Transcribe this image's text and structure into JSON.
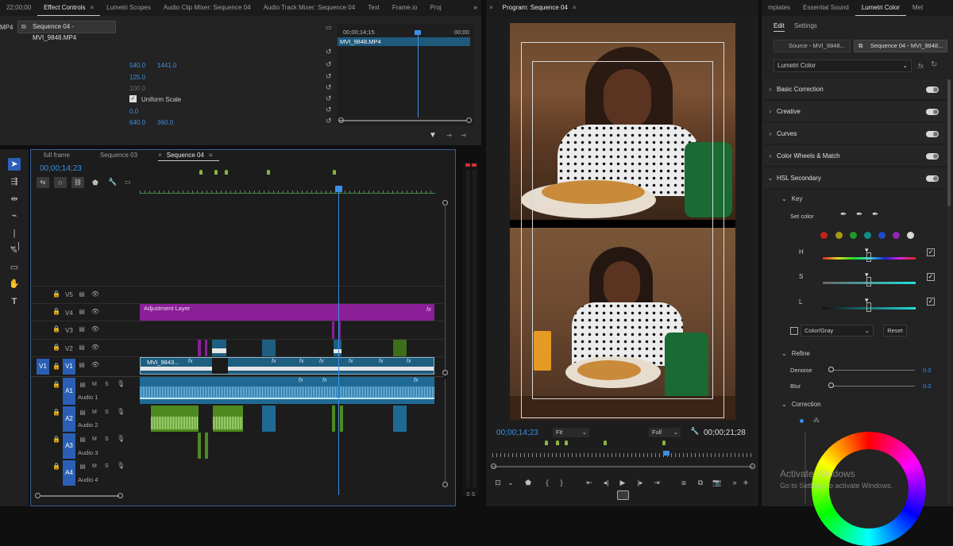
{
  "effect_controls": {
    "tabs": [
      {
        "label": "22;00;00",
        "active": false
      },
      {
        "label": "Effect Controls",
        "active": true
      },
      {
        "label": "Lumetri Scopes",
        "active": false
      },
      {
        "label": "Audio Clip Mixer: Sequence 04",
        "active": false
      },
      {
        "label": "Audio Track Mixer: Sequence 04",
        "active": false
      },
      {
        "label": "Text",
        "active": false
      },
      {
        "label": "Frame.io",
        "active": false
      },
      {
        "label": "Proj",
        "active": false
      }
    ],
    "source_left": "MP4",
    "source_dropdown": "Sequence 04 - MVI_9848.MP4",
    "position_x": "540.0",
    "position_y": "1441.0",
    "scale": "125.0",
    "scale_width": "100.0",
    "uniform_scale": "Uniform Scale",
    "rotation": "0.0",
    "anchor_x": "640.0",
    "anchor_y": "360.0",
    "ruler_start": "00;00;14;15",
    "ruler_end": "00;00",
    "clip_name": "MVI_9848.MP4"
  },
  "timeline": {
    "tabs": [
      {
        "label": "full frame",
        "active": false
      },
      {
        "label": "Sequence 03",
        "active": false
      },
      {
        "label": "Sequence 04",
        "active": true
      }
    ],
    "close_glyph": "×",
    "menu_glyph": "≡",
    "timecode": "00;00;14;23",
    "video_tracks": [
      {
        "id": "V5",
        "label": "V5"
      },
      {
        "id": "V4",
        "label": "V4"
      },
      {
        "id": "V3",
        "label": "V3"
      },
      {
        "id": "V2",
        "label": "V2"
      },
      {
        "id": "V1",
        "label": "V1",
        "source": "V1"
      }
    ],
    "audio_tracks": [
      {
        "id": "A1",
        "label": "A1",
        "name": "Audio 1"
      },
      {
        "id": "A2",
        "label": "A2",
        "name": "Audio 2"
      },
      {
        "id": "A3",
        "label": "A3",
        "name": "Audio 3"
      },
      {
        "id": "A4",
        "label": "A4",
        "name": "Audio 4"
      }
    ],
    "track_buttons": {
      "mute": "M",
      "solo": "S"
    },
    "adjustment_layer": "Adjustment Layer",
    "v1_clip": "MVI_9843...",
    "fx": "fx",
    "meter_bottom": "S S"
  },
  "program": {
    "title": "Program: Sequence 04",
    "timecode": "00;00;14;23",
    "fit": "Fit",
    "quality": "Full",
    "duration": "00;00;21;28"
  },
  "lumetri": {
    "tabs": [
      {
        "label": "mplates",
        "active": false
      },
      {
        "label": "Essential Sound",
        "active": false
      },
      {
        "label": "Lumetri Color",
        "active": true
      },
      {
        "label": "Met",
        "active": false
      }
    ],
    "subtabs": {
      "edit": "Edit",
      "settings": "Settings"
    },
    "source_tab": "Source - MVI_9848...",
    "seq_tab": "Sequence 04 - MVI_9848...",
    "effect_select": "Lumetri Color",
    "sections": [
      {
        "label": "Basic Correction"
      },
      {
        "label": "Creative"
      },
      {
        "label": "Curves"
      },
      {
        "label": "Color Wheels & Match"
      },
      {
        "label": "HSL Secondary"
      }
    ],
    "key": "Key",
    "set_color": "Set color",
    "swatches": [
      "#c0231d",
      "#a39a12",
      "#1f9b2a",
      "#0f8f86",
      "#1f49c6",
      "#8b28b5",
      "#d8d8d8"
    ],
    "h": "H",
    "s": "S",
    "l": "L",
    "color_gray": "Color/Gray",
    "reset": "Reset",
    "refine": "Refine",
    "denoise": "Denoise",
    "denoise_val": "0.0",
    "blur": "Blur",
    "blur_val": "0.0",
    "correction": "Correction",
    "activate_title": "Activate Windows",
    "activate_sub": "Go to Settings to activate Windows."
  }
}
